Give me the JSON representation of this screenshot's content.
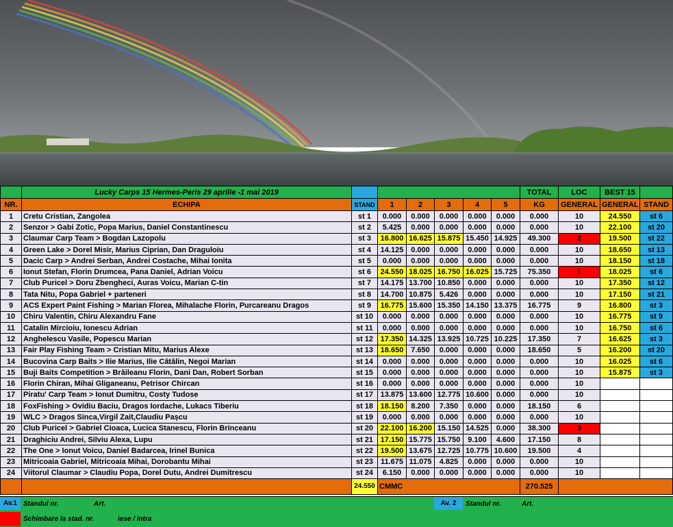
{
  "title": "Lucky Carps 15 Hermes-Peris 29 aprilie -1 mai 2019",
  "top_headers": {
    "total": "TOTAL",
    "loc": "LOC",
    "best": "BEST 15"
  },
  "headers": {
    "nr": "NR.",
    "echipa": "ECHIPA",
    "stand": "STAND",
    "r1": "1",
    "r2": "2",
    "r3": "3",
    "r4": "4",
    "r5": "5",
    "kg": "KG",
    "general": "GENERAL",
    "best_general": "GENERAL",
    "best_stand": "STAND"
  },
  "rows": [
    {
      "nr": "1",
      "echipa": "Cretu Cristian, Zangolea",
      "stand": "st 1",
      "v": [
        "0.000",
        "0.000",
        "0.000",
        "0.000",
        "0.000"
      ],
      "total": "0.000",
      "loc": "10",
      "best": "24.550",
      "bstand": "st 6"
    },
    {
      "nr": "2",
      "echipa": "Senzor > Gabi Zotic, Popa Marius, Daniel Constantinescu",
      "stand": "st 2",
      "v": [
        "5.425",
        "0.000",
        "0.000",
        "0.000",
        "0.000"
      ],
      "total": "0.000",
      "loc": "10",
      "best": "22.100",
      "bstand": "st 20"
    },
    {
      "nr": "3",
      "echipa": "Claumar Carp Team > Bogdan Lazopolu",
      "stand": "st 3",
      "v": [
        "16.800",
        "16.625",
        "15.875",
        "15.450",
        "14.925"
      ],
      "total": "49.300",
      "loc": "2",
      "best": "19.500",
      "bstand": "st 22"
    },
    {
      "nr": "4",
      "echipa": "Green Lake > Dorel Misir, Marius Ciprian, Dan Draguloiu",
      "stand": "st 4",
      "v": [
        "14.125",
        "0.000",
        "0.000",
        "0.000",
        "0.000"
      ],
      "total": "0.000",
      "loc": "10",
      "best": "18.650",
      "bstand": "st 13"
    },
    {
      "nr": "5",
      "echipa": "Dacic Carp > Andrei Serban, Andrei Costache, Mihai Ionita",
      "stand": "st 5",
      "v": [
        "0.000",
        "0.000",
        "0.000",
        "0.000",
        "0.000"
      ],
      "total": "0.000",
      "loc": "10",
      "best": "18.150",
      "bstand": "st 18"
    },
    {
      "nr": "6",
      "echipa": "Ionut Stefan, Florin Drumcea, Pana Daniel, Adrian Voicu",
      "stand": "st 6",
      "v": [
        "24.550",
        "18.025",
        "16.750",
        "16.025",
        "15.725"
      ],
      "total": "75.350",
      "loc": "1",
      "best": "18.025",
      "bstand": "st 6"
    },
    {
      "nr": "7",
      "echipa": "Club Puricel  > Doru Zbengheci, Auras Voicu, Marian C-tin",
      "stand": "st 7",
      "v": [
        "14.175",
        "13.700",
        "10.850",
        "0.000",
        "0.000"
      ],
      "total": "0.000",
      "loc": "10",
      "best": "17.350",
      "bstand": "st 12"
    },
    {
      "nr": "8",
      "echipa": "Tata Nitu, Popa Gabriel + parteneri",
      "stand": "st 8",
      "v": [
        "14.700",
        "10.875",
        "5.426",
        "0.000",
        "0.000"
      ],
      "total": "0.000",
      "loc": "10",
      "best": "17.150",
      "bstand": "st 21"
    },
    {
      "nr": "9",
      "echipa": "ACS Expert Paint Fishing  > Marian Florea, Mihalache Florin, Purcareanu Dragos",
      "stand": "st 9",
      "v": [
        "16.775",
        "15.600",
        "15.350",
        "14.150",
        "13.375"
      ],
      "total": "16.775",
      "loc": "9",
      "best": "16.800",
      "bstand": "st 3"
    },
    {
      "nr": "10",
      "echipa": "Chiru Valentin, Chiru Alexandru Fane",
      "stand": "st 10",
      "v": [
        "0.000",
        "0.000",
        "0.000",
        "0.000",
        "0.000"
      ],
      "total": "0.000",
      "loc": "10",
      "best": "16.775",
      "bstand": "st 9"
    },
    {
      "nr": "11",
      "echipa": "Catalin Mircioiu, Ionescu Adrian",
      "stand": "st 11",
      "v": [
        "0.000",
        "0.000",
        "0.000",
        "0.000",
        "0.000"
      ],
      "total": "0.000",
      "loc": "10",
      "best": "16.750",
      "bstand": "st 6"
    },
    {
      "nr": "12",
      "echipa": "Anghelescu Vasile, Popescu Marian",
      "stand": "st 12",
      "v": [
        "17.350",
        "14.325",
        "13.925",
        "10.725",
        "10.225"
      ],
      "total": "17.350",
      "loc": "7",
      "best": "16.625",
      "bstand": "st 3"
    },
    {
      "nr": "13",
      "echipa": "Fair Play Fishing Team > Cristian Mitu, Marius Alexe",
      "stand": "st 13",
      "v": [
        "18.650",
        "7.650",
        "0.000",
        "0.000",
        "0.000"
      ],
      "total": "18.650",
      "loc": "5",
      "best": "16.200",
      "bstand": "st 20"
    },
    {
      "nr": "14",
      "echipa": "Bucovina Carp Baits  > Ilie Marius, Ilie Cătălin, Negoi Marian",
      "stand": "st 14",
      "v": [
        "0.000",
        "0.000",
        "0.000",
        "0.000",
        "0.000"
      ],
      "total": "0.000",
      "loc": "10",
      "best": "16.025",
      "bstand": "st 6"
    },
    {
      "nr": "15",
      "echipa": "Buji Baits Competition > Brăileanu Florin, Dani Dan, Robert Sorban",
      "stand": "st 15",
      "v": [
        "0.000",
        "0.000",
        "0.000",
        "0.000",
        "0.000"
      ],
      "total": "0.000",
      "loc": "10",
      "best": "15.875",
      "bstand": "st 3"
    },
    {
      "nr": "16",
      "echipa": "Florin Chiran, Mihai Gliganeanu, Petrisor Chircan",
      "stand": "st 16",
      "v": [
        "0.000",
        "0.000",
        "0.000",
        "0.000",
        "0.000"
      ],
      "total": "0.000",
      "loc": "10",
      "best": "",
      "bstand": ""
    },
    {
      "nr": "17",
      "echipa": "Piratu' Carp Team  > Ionut Dumitru, Costy Tudose",
      "stand": "st 17",
      "v": [
        "13.875",
        "13.600",
        "12.775",
        "10.600",
        "0.000"
      ],
      "total": "0.000",
      "loc": "10",
      "best": "",
      "bstand": ""
    },
    {
      "nr": "18",
      "echipa": "FoxFishing > Ovidiu Baciu, Dragos Iordache, Lukacs Tiberiu",
      "stand": "st 18",
      "v": [
        "18.150",
        "8.200",
        "7.350",
        "0.000",
        "0.000"
      ],
      "total": "18.150",
      "loc": "6",
      "best": "",
      "bstand": ""
    },
    {
      "nr": "19",
      "echipa": "WLC > Dragos Sinca,Virgil Zait,Claudiu Pașcu",
      "stand": "st 19",
      "v": [
        "0.000",
        "0.000",
        "0.000",
        "0.000",
        "0.000"
      ],
      "total": "0.000",
      "loc": "10",
      "best": "",
      "bstand": ""
    },
    {
      "nr": "20",
      "echipa": "Club Puricel  > Gabriel Cioaca, Lucica Stanescu, Florin Brinceanu",
      "stand": "st 20",
      "v": [
        "22.100",
        "16.200",
        "15.150",
        "14.525",
        "0.000"
      ],
      "total": "38.300",
      "loc": "3",
      "best": "",
      "bstand": ""
    },
    {
      "nr": "21",
      "echipa": "Draghiciu Andrei, Silviu Alexa, Lupu",
      "stand": "st 21",
      "v": [
        "17.150",
        "15.775",
        "15.750",
        "9.100",
        "4.600"
      ],
      "total": "17.150",
      "loc": "8",
      "best": "",
      "bstand": ""
    },
    {
      "nr": "22",
      "echipa": "The One  > Ionut Voicu, Daniel Badarcea, Irinel Bunica",
      "stand": "st 22",
      "v": [
        "19.500",
        "13.675",
        "12.725",
        "10.775",
        "10.600"
      ],
      "total": "19.500",
      "loc": "4",
      "best": "",
      "bstand": ""
    },
    {
      "nr": "23",
      "echipa": "Mitricoaia Gabriel, Mitricoaia Mihai, Dorobantu Mihai",
      "stand": "st 23",
      "v": [
        "11.675",
        "11.075",
        "4.825",
        "0.000",
        "0.000"
      ],
      "total": "0.000",
      "loc": "10",
      "best": "",
      "bstand": ""
    },
    {
      "nr": "24",
      "echipa": "Viitorul Claumar > Claudiu Popa, Dorel Dutu, Andrei Dumitrescu",
      "stand": "st 24",
      "v": [
        "6.150",
        "0.000",
        "0.000",
        "0.000",
        "0.000"
      ],
      "total": "0.000",
      "loc": "10",
      "best": "",
      "bstand": ""
    }
  ],
  "summary": {
    "best_value": "24.550",
    "cmmc": "CMMC",
    "total_kg": "270.525"
  },
  "footer": {
    "av1": "Av.1",
    "standul1": "Standul nr.",
    "art1": "Art.",
    "av2": "Av. 2",
    "standul2": "Standul  nr.",
    "art2": "Art.",
    "schimbare": "Schimbare la stad.  nr.",
    "iese": "iese / intra"
  },
  "colors": {
    "green": "#22b14c",
    "orange": "#e46c0a",
    "blue": "#29a8e0",
    "yellow": "#ffff33",
    "red": "#ff0000",
    "lavender": "#e9e6f2"
  }
}
